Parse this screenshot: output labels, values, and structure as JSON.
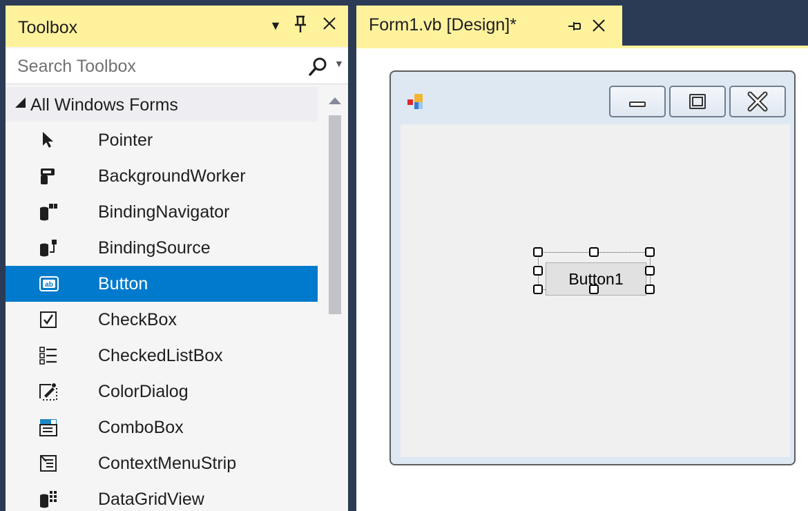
{
  "toolbox": {
    "title": "Toolbox",
    "search_placeholder": "Search Toolbox",
    "category": "All Windows Forms",
    "items": [
      {
        "label": "Pointer",
        "icon": "pointer-icon"
      },
      {
        "label": "BackgroundWorker",
        "icon": "backgroundworker-icon"
      },
      {
        "label": "BindingNavigator",
        "icon": "bindingnavigator-icon"
      },
      {
        "label": "BindingSource",
        "icon": "bindingsource-icon"
      },
      {
        "label": "Button",
        "icon": "button-icon",
        "selected": true
      },
      {
        "label": "CheckBox",
        "icon": "checkbox-icon"
      },
      {
        "label": "CheckedListBox",
        "icon": "checkedlistbox-icon"
      },
      {
        "label": "ColorDialog",
        "icon": "colordialog-icon"
      },
      {
        "label": "ComboBox",
        "icon": "combobox-icon"
      },
      {
        "label": "ContextMenuStrip",
        "icon": "contextmenustrip-icon"
      },
      {
        "label": "DataGridView",
        "icon": "datagridview-icon"
      }
    ]
  },
  "document": {
    "tab_title": "Form1.vb [Design]*"
  },
  "form": {
    "button_text": "Button1"
  },
  "colors": {
    "chrome_dark": "#2b3a55",
    "active_header": "#fff29d",
    "selection": "#007acc"
  }
}
